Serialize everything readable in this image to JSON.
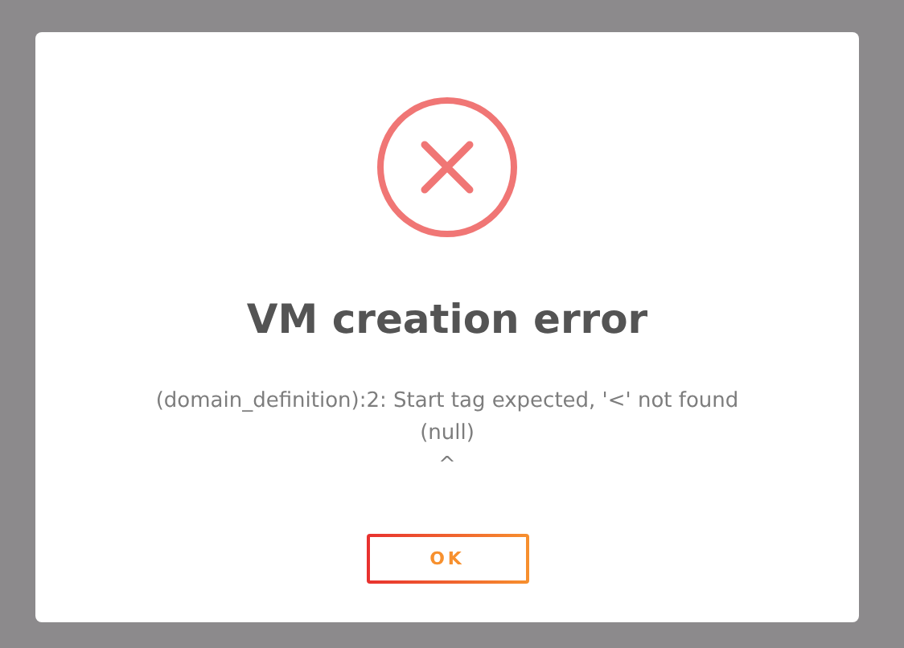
{
  "dialog": {
    "title": "VM creation error",
    "message_lines": [
      "(domain_definition):2: Start tag expected, '<' not found",
      "(null)",
      "^"
    ],
    "buttons": [
      "OK"
    ]
  }
}
